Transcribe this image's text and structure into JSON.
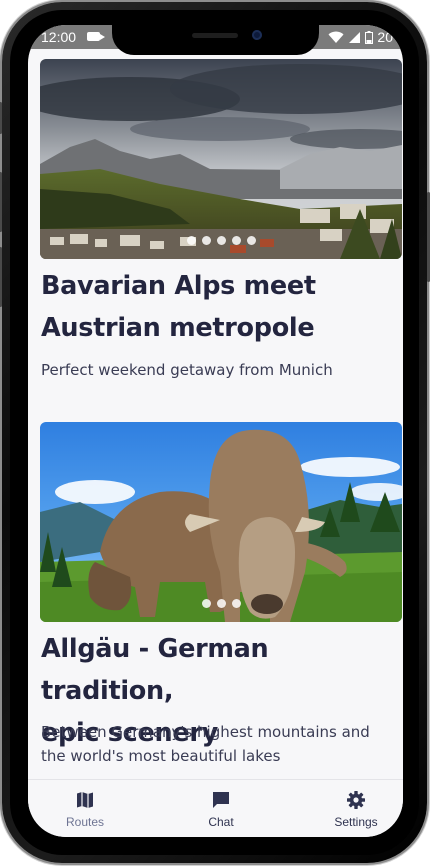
{
  "status_bar": {
    "time": "12:00",
    "battery": "20"
  },
  "cards": [
    {
      "title_line1": "Bavarian Alps meet",
      "title_line2": "Austrian metropole",
      "subtitle_line1": "Perfect weekend getaway from Munich",
      "subtitle_line2": "",
      "slide_count": 5
    },
    {
      "title_line1": "Allgäu - German tradition,",
      "title_line2": "epic scenery",
      "subtitle_line1": "Between Germany's highest mountains and",
      "subtitle_line2": "the world's most beautiful lakes",
      "slide_count": 3
    }
  ],
  "tab_bar": {
    "tabs": [
      {
        "label": "Routes",
        "icon": "map-icon",
        "active": true
      },
      {
        "label": "Chat",
        "icon": "chat-icon",
        "active": false
      },
      {
        "label": "Settings",
        "icon": "gear-icon",
        "active": false
      }
    ]
  },
  "colors": {
    "title": "#23253f",
    "tab_active": "#6e7493",
    "tab_inactive": "#2f3350",
    "status_bar": "#7b7b7b"
  }
}
